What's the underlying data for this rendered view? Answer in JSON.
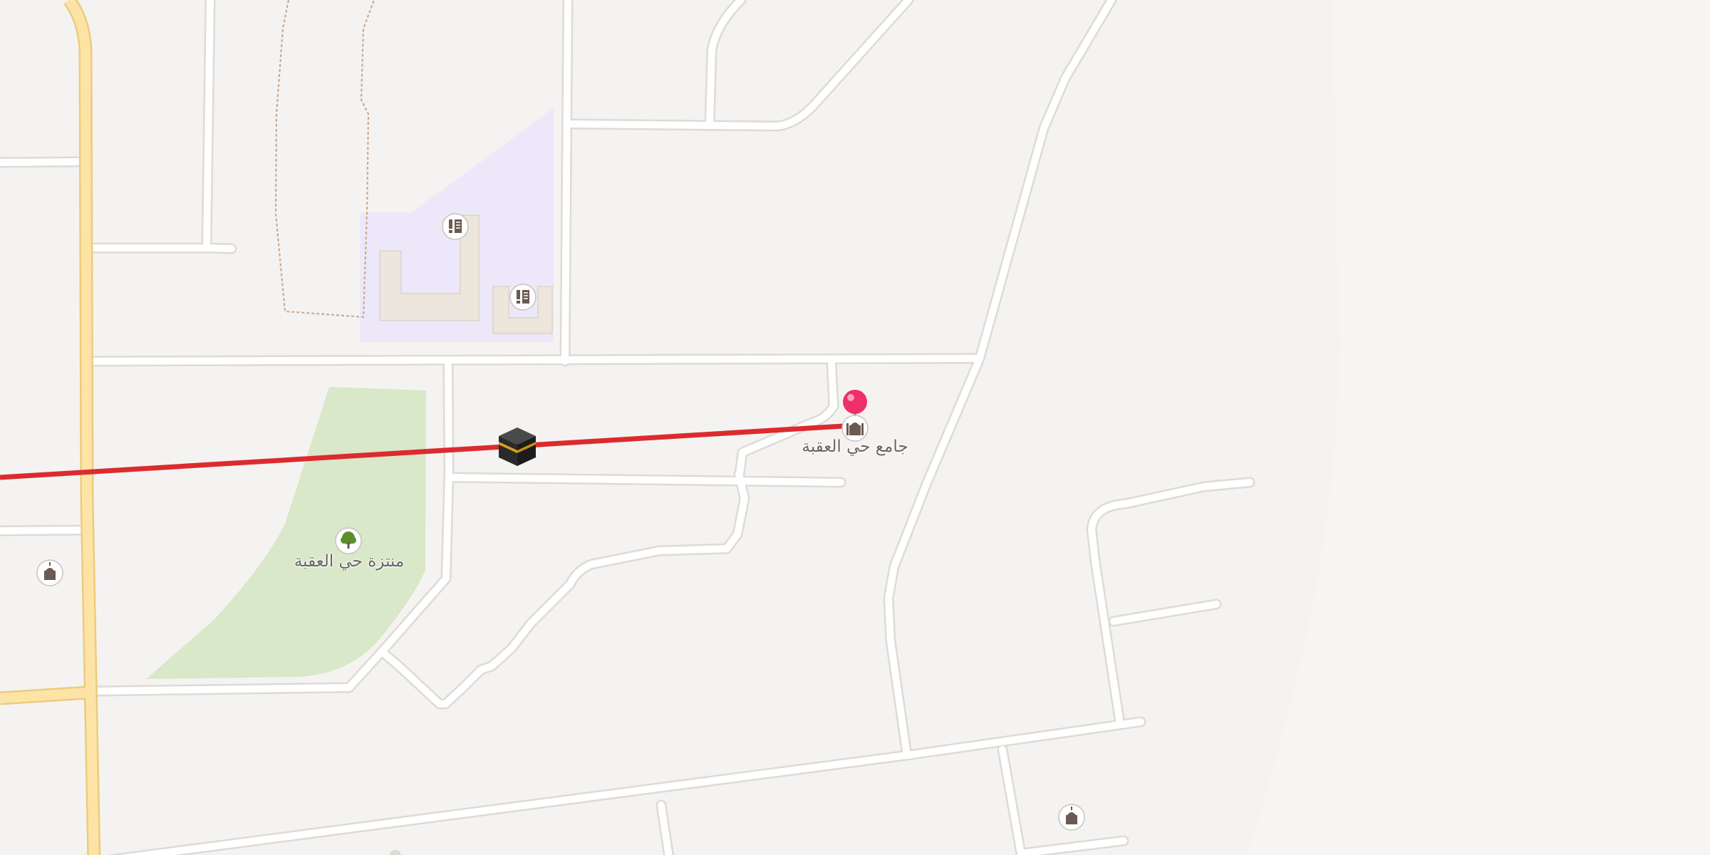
{
  "map": {
    "colors": {
      "background": "#f5f3f1",
      "minor_road": "#ffffff",
      "road_casing": "#dedad6",
      "major_road_fill": "#fde4a6",
      "major_road_casing": "#eccb7c",
      "school_area": "#ece8fa",
      "park_area": "#d8e8c8",
      "building": "#ece6dd",
      "qibla_line": "#dc2b2e",
      "pin": "#ee2f6a",
      "poi_icon": "#6b5a52",
      "park_icon": "#5a8f2a"
    },
    "pois": [
      {
        "id": "school-1",
        "type": "school",
        "icon": "school-icon"
      },
      {
        "id": "school-2",
        "type": "school",
        "icon": "school-icon"
      },
      {
        "id": "mosque-selected",
        "type": "mosque",
        "icon": "mosque-icon",
        "label": "جامع حي العقبة"
      },
      {
        "id": "park",
        "type": "park",
        "icon": "tree-icon",
        "label": "منتزة حي العقبة"
      },
      {
        "id": "mosque-west",
        "type": "mosque",
        "icon": "mosque-icon"
      },
      {
        "id": "mosque-southeast",
        "type": "mosque",
        "icon": "mosque-icon"
      }
    ],
    "markers": {
      "kaaba": {
        "icon": "kaaba-icon"
      },
      "location_pin": {
        "icon": "location-pin-icon"
      }
    }
  }
}
